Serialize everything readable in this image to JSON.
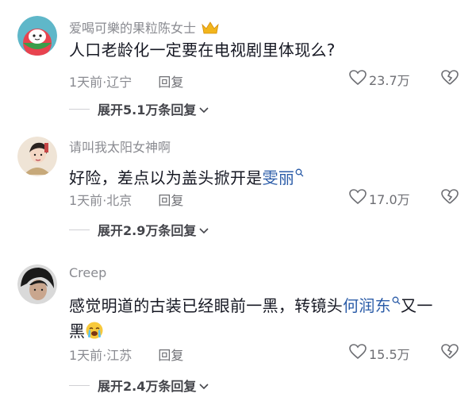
{
  "comments": [
    {
      "username": "爱喝可樂的果粒陈女士",
      "text": "人口老龄化一定要在电视剧里体现么?",
      "time": "1天前",
      "location": "辽宁",
      "reply": "回复",
      "likes": "23.7万",
      "expand": "展开5.1万条回复"
    },
    {
      "username": "请叫我太阳女神啊",
      "text_before": "好险，差点以为盖头掀开是",
      "link": "雯丽",
      "time": "1天前",
      "location": "北京",
      "reply": "回复",
      "likes": "17.0万",
      "expand": "展开2.9万条回复"
    },
    {
      "username": "Creep",
      "text_before": "感觉明道的古装已经眼前一黑，转镜头",
      "link": "何润东",
      "text_after": "又一",
      "text_line2": "黑",
      "time": "1天前",
      "location": "江苏",
      "reply": "回复",
      "likes": "15.5万",
      "expand": "展开2.4万条回复"
    }
  ],
  "separator": "·",
  "icons": [
    "heart-icon",
    "broken-heart-icon",
    "chevron-down-icon",
    "search-icon",
    "crown-icon",
    "crying-emoji-icon"
  ]
}
